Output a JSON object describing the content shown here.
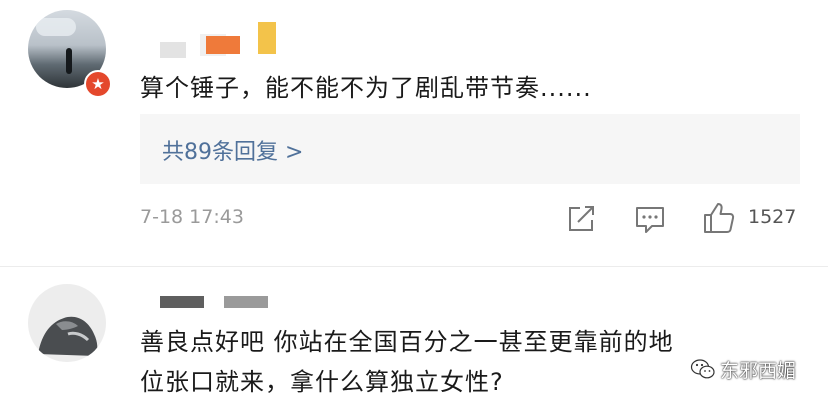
{
  "comments": [
    {
      "text": "算个锤子，能不能不为了剧乱带节奏......",
      "replies_label": "共89条回复 >",
      "timestamp": "7-18 17:43",
      "likes": "1527"
    },
    {
      "text_line1": "善良点好吧 你站在全国百分之一甚至更靠前的地",
      "text_line2": "位张口就来，拿什么算独立女性?"
    }
  ],
  "watermark": {
    "text": "东邪西媚"
  },
  "colors": {
    "link": "#50719a",
    "badge": "#e4482c",
    "meta": "#9a9a9a"
  }
}
